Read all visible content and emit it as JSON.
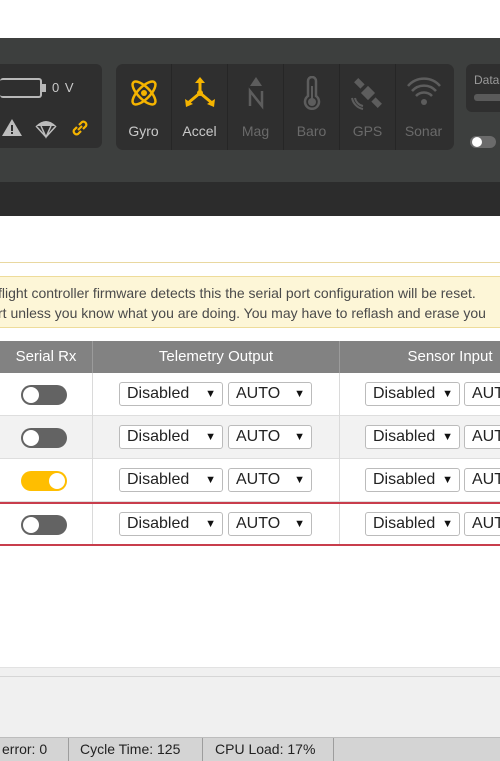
{
  "header": {
    "voltage": "0 V",
    "sensors": [
      {
        "label": "Gyro",
        "icon": "gyro-icon",
        "active": true
      },
      {
        "label": "Accel",
        "icon": "accel-icon",
        "active": true
      },
      {
        "label": "Mag",
        "icon": "mag-icon",
        "active": false
      },
      {
        "label": "Baro",
        "icon": "baro-icon",
        "active": false
      },
      {
        "label": "GPS",
        "icon": "gps-icon",
        "active": false
      },
      {
        "label": "Sonar",
        "icon": "sonar-icon",
        "active": false
      }
    ],
    "dataflash_label": "Data",
    "colors": {
      "active": "#f5b400",
      "inactive": "#5d5d5d"
    }
  },
  "note": {
    "line1": "flight controller firmware detects this the serial port configuration will be reset.",
    "line2": "rt unless you know what you are doing. You may have to reflash and erase you"
  },
  "table": {
    "columns": [
      "Serial Rx",
      "Telemetry Output",
      "Sensor Input"
    ],
    "rows": [
      {
        "serial_rx": false,
        "telemetry": "Disabled",
        "telemetry_baud": "AUTO",
        "sensor": "Disabled",
        "sensor_baud": "AUTO"
      },
      {
        "serial_rx": false,
        "telemetry": "Disabled",
        "telemetry_baud": "AUTO",
        "sensor": "Disabled",
        "sensor_baud": "AUTO"
      },
      {
        "serial_rx": true,
        "telemetry": "Disabled",
        "telemetry_baud": "AUTO",
        "sensor": "Disabled",
        "sensor_baud": "AUTO"
      },
      {
        "serial_rx": false,
        "telemetry": "Disabled",
        "telemetry_baud": "AUTO",
        "sensor": "Disabled",
        "sensor_baud": "AUTO"
      }
    ]
  },
  "statusbar": {
    "error": "error: 0",
    "cycle_time": "Cycle Time: 125",
    "cpu_load": "CPU Load: 17%"
  }
}
